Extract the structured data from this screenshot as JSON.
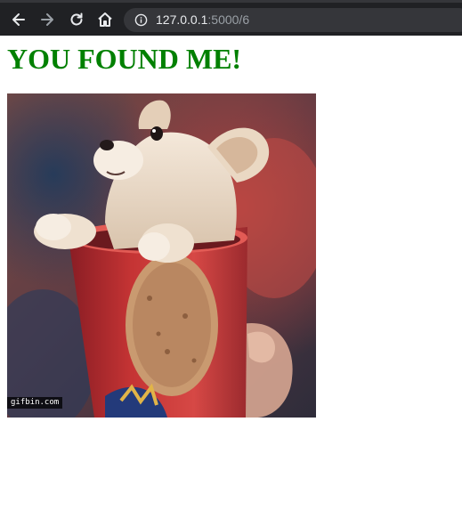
{
  "browser": {
    "url_host": "127.0.0.1",
    "url_rest": ":5000/6",
    "icons": {
      "back": "back-arrow-icon",
      "forward": "forward-arrow-icon",
      "reload": "reload-icon",
      "home": "home-icon",
      "info": "info-icon"
    }
  },
  "page": {
    "heading": "YOU FOUND ME!",
    "heading_color": "#008000",
    "image_alt": "Puppy in a cup GIF",
    "image_watermark": "gifbin.com"
  }
}
